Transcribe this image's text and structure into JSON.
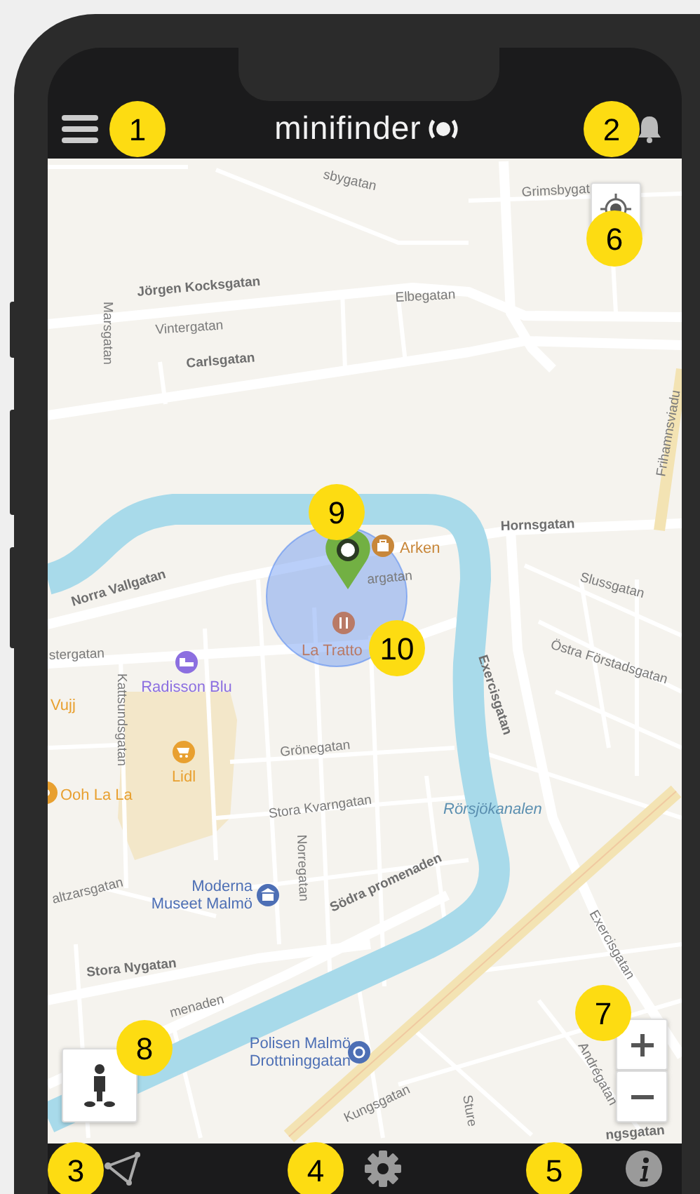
{
  "header": {
    "logo": "minifinder"
  },
  "map": {
    "streets": [
      {
        "text": "sbygatan"
      },
      {
        "text": "Grimsbygat"
      },
      {
        "text": "Jörgen Kocksgatan"
      },
      {
        "text": "Elbegatan"
      },
      {
        "text": "Marsgatan"
      },
      {
        "text": "Vintergatan"
      },
      {
        "text": "Carlsgatan"
      },
      {
        "text": "Frihamnsviadu"
      },
      {
        "text": "Hornsgatan"
      },
      {
        "text": "Norra Vallgatan"
      },
      {
        "text": "argatan"
      },
      {
        "text": "Slussgatan"
      },
      {
        "text": "stergatan"
      },
      {
        "text": "Östra Förstadsgatan"
      },
      {
        "text": "Exercisgatan"
      },
      {
        "text": "Kattsundsgatan"
      },
      {
        "text": "Grönegatan"
      },
      {
        "text": "Stora Kvarngatan"
      },
      {
        "text": "Norregatan"
      },
      {
        "text": "Södra promenaden"
      },
      {
        "text": "altzarsgatan"
      },
      {
        "text": "Stora Nygatan"
      },
      {
        "text": "menaden"
      },
      {
        "text": "Kungsgatan"
      },
      {
        "text": "Exercisgatan"
      },
      {
        "text": "Andrégatan"
      },
      {
        "text": "Sture"
      },
      {
        "text": "ngsgatan"
      }
    ],
    "water": [
      {
        "text": "Rörsjökanalen"
      }
    ],
    "places": [
      {
        "kind": "bag",
        "lines": [
          "Arken"
        ],
        "color": "#c8873a"
      },
      {
        "kind": "cutlery",
        "lines": [
          "La Tratto"
        ],
        "color": "#b97a66"
      },
      {
        "kind": "bed",
        "lines": [
          "Radisson Blu"
        ],
        "color": "#8c6fe0"
      },
      {
        "kind": "text",
        "lines": [
          "Vujj"
        ],
        "color": "#e8a030"
      },
      {
        "kind": "cart",
        "lines": [
          "Lidl"
        ],
        "color": "#e8a030"
      },
      {
        "kind": "dot",
        "lines": [
          "Ooh La La"
        ],
        "color": "#e8a030"
      },
      {
        "kind": "museum",
        "lines": [
          "Moderna",
          "Museet Malmö"
        ],
        "color": "#4d6fb5"
      },
      {
        "kind": "police",
        "lines": [
          "Polisen Malmö",
          "Drottninggatan"
        ],
        "color": "#4d6fb5"
      }
    ]
  },
  "callouts": [
    "1",
    "2",
    "6",
    "9",
    "10",
    "7",
    "8",
    "3",
    "4",
    "5"
  ]
}
